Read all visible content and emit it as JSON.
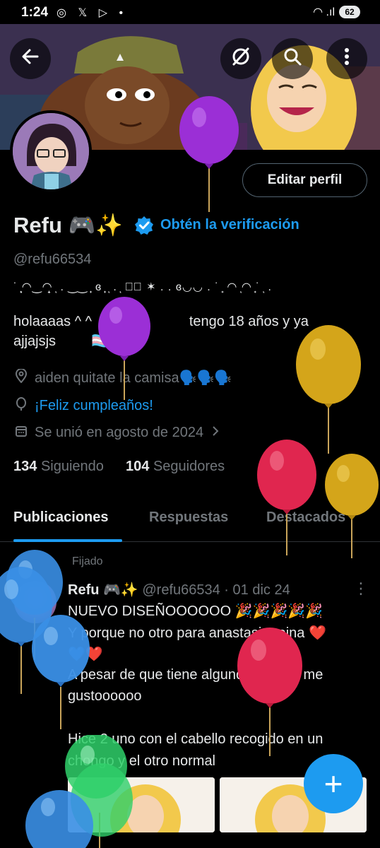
{
  "status_bar": {
    "time": "1:24",
    "left_icons": "◎ 𝕏 ▷ •",
    "right_icons": "◠ .ıl",
    "battery": "62"
  },
  "header": {
    "back_icon": "arrow-left-icon",
    "actions": [
      "grok-icon",
      "search-icon",
      "more-vertical-icon"
    ]
  },
  "profile": {
    "edit_button": "Editar perfil",
    "display_name": "Refu 🎮✨",
    "verify_link": "Obtén la verificación",
    "handle": "@refu66534",
    "decoration": "˙ ̟ͅ◠‿◠̟ ͅ . ‿‿ ̟ ɞ ̟ ͅ . ͅ ♡⃝ ✶ . . ɞ◡◡ . ˙ ̟ ◠ ͅ◠ ̟˙ ͅ .",
    "bio_line1": "holaaaas ^ ^   jsjsjs              tengo 18 años y ya",
    "bio_line2": "ajjajsjs         🏳️‍⚧️🇲🇽",
    "location": "aiden quitate la camisa🗣️🗣️🗣️",
    "birthday": "¡Feliz cumpleaños!",
    "joined": "Se unió en agosto de 2024",
    "following_count": "134",
    "following_label": "Siguiendo",
    "followers_count": "104",
    "followers_label": "Seguidores"
  },
  "tabs": [
    "Publicaciones",
    "Respuestas",
    "Destacados"
  ],
  "tweet": {
    "pinned_label": "Fijado",
    "name": "Refu 🎮✨",
    "handle_date": " @refu66534 · 01 dic 24",
    "lines": [
      "NUEVO DISEÑOOOOOO 🎉🎉🎉🎉🎉",
      "Y porque no otro para anastasia reina ❤️",
      "💙❤️",
      "A pesar de que tiene algunos errores me",
      "gustoooooo",
      "",
      "Hice 2 uno con el cabello recogido en un",
      "chongo y el otro normal"
    ]
  },
  "fab_label": "+",
  "colors": {
    "accent": "#1d9bf0",
    "background": "#000000",
    "muted": "#71767b",
    "balloon_purple": "#9b2fd6",
    "balloon_gold": "#d4a51a",
    "balloon_red": "#e0264f",
    "balloon_blue": "#3a8fe6",
    "balloon_green": "#2fd06a"
  }
}
